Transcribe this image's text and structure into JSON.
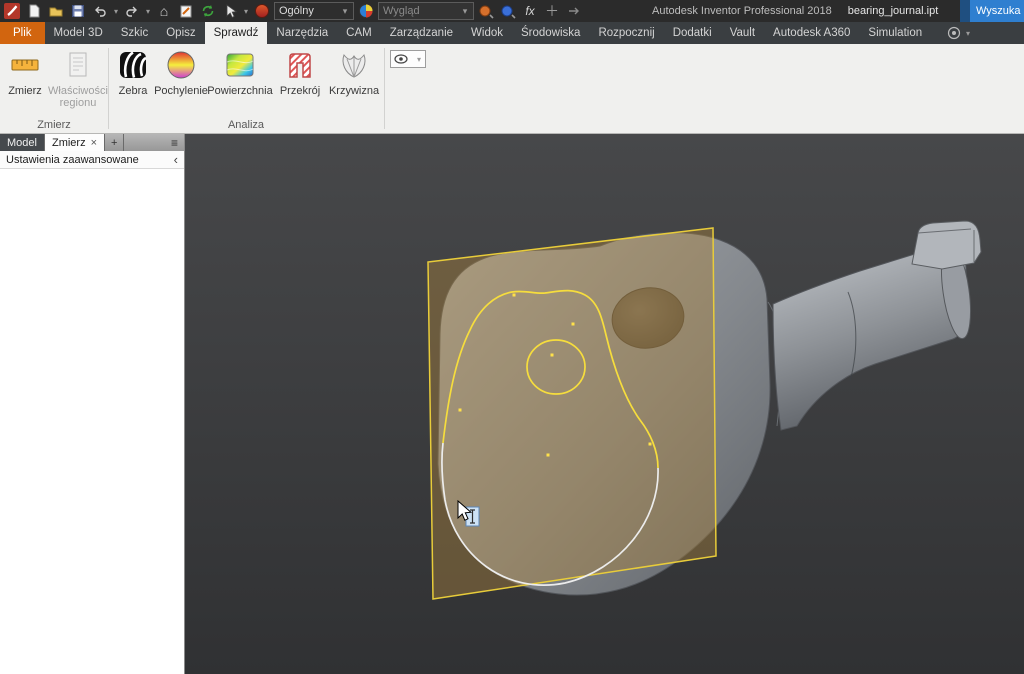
{
  "titlebar": {
    "app_title": "Autodesk Inventor Professional 2018",
    "doc_title": "bearing_journal.ipt",
    "search_label": "Wyszuka",
    "material_value": "Ogólny",
    "appearance_value": "Wygląd",
    "fx_label": "fx"
  },
  "ribbon": {
    "tabs": [
      "Plik",
      "Model 3D",
      "Szkic",
      "Opisz",
      "Sprawdź",
      "Narzędzia",
      "CAM",
      "Zarządzanie",
      "Widok",
      "Środowiska",
      "Rozpocznij",
      "Dodatki",
      "Vault",
      "Autodesk A360",
      "Simulation"
    ],
    "active_tab": "Sprawdź",
    "groups": [
      {
        "label": "Zmierz",
        "tools": [
          {
            "label": "Zmierz"
          },
          {
            "label": "Właściwości regionu"
          }
        ]
      },
      {
        "label": "Analiza",
        "tools": [
          {
            "label": "Zebra"
          },
          {
            "label": "Pochylenie"
          },
          {
            "label": "Powierzchnia"
          },
          {
            "label": "Przekrój"
          },
          {
            "label": "Krzywizna"
          }
        ]
      }
    ]
  },
  "browser_panel": {
    "tabs": [
      {
        "label": "Model"
      },
      {
        "label": "Zmierz"
      },
      {
        "label": "+"
      }
    ],
    "advanced_settings_label": "Ustawienia zaawansowane"
  },
  "viewport": {
    "content": "3D part bearing_journal with yellow section plane and cross-section contour",
    "section_outline_color": "#f6dd3d",
    "section_cut_color": "#ececec"
  },
  "colors": {
    "file_tab_orange": "#d2650f",
    "search_blue": "#2f7fd0",
    "ribbon_bg": "#f0f0ee",
    "titlebar_bg": "#2b2b2b"
  },
  "icons": {
    "titlebar": [
      "app-logo",
      "new-document",
      "open-folder",
      "save",
      "undo",
      "redo",
      "home",
      "sketch",
      "update",
      "material-sphere",
      "appearance-ball",
      "adjust-orange",
      "adjust-blue",
      "fx",
      "plus",
      "arrow"
    ],
    "ribbon_right": "ribbon-display-options",
    "analysis_combo": "visibility-eye"
  }
}
